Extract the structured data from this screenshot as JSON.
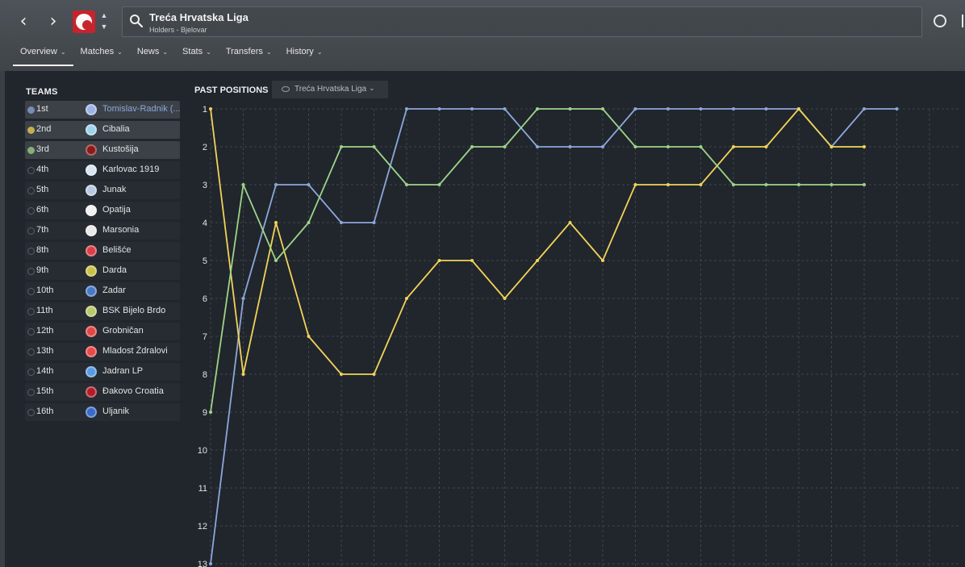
{
  "header": {
    "title": "Treća Hrvatska Liga",
    "subtitle": "Holders - Bjelovar",
    "back_glyph": "‹",
    "forward_glyph": "›",
    "tabs": [
      {
        "label": "Overview",
        "active": true
      },
      {
        "label": "Matches",
        "active": false
      },
      {
        "label": "News",
        "active": false
      },
      {
        "label": "Stats",
        "active": false
      },
      {
        "label": "Transfers",
        "active": false
      },
      {
        "label": "History",
        "active": false
      }
    ]
  },
  "teams": {
    "header": "TEAMS",
    "rows": [
      {
        "pos": "1st",
        "name": "Tomislav-Radnik (...",
        "crest": "#9db3e8",
        "marker": "#8ea6dc",
        "highlight": true,
        "link": true
      },
      {
        "pos": "2nd",
        "name": "Cibalia",
        "crest": "#9fd3ec",
        "marker": "#f2d35a",
        "highlight": true,
        "link": false
      },
      {
        "pos": "3rd",
        "name": "Kustošija",
        "crest": "#8b1a1a",
        "marker": "#9fd38a",
        "highlight": true,
        "link": false
      },
      {
        "pos": "4th",
        "name": "Karlovac 1919",
        "crest": "#d8e4f0",
        "highlight": false
      },
      {
        "pos": "5th",
        "name": "Junak",
        "crest": "#b8c8e0",
        "highlight": false
      },
      {
        "pos": "6th",
        "name": "Opatija",
        "crest": "#f2f2f2",
        "highlight": false
      },
      {
        "pos": "7th",
        "name": "Marsonia",
        "crest": "#e8e8e8",
        "highlight": false
      },
      {
        "pos": "8th",
        "name": "Belišće",
        "crest": "#d9404a",
        "highlight": false
      },
      {
        "pos": "9th",
        "name": "Darda",
        "crest": "#c9c24a",
        "highlight": false
      },
      {
        "pos": "10th",
        "name": "Zadar",
        "crest": "#4a78c8",
        "highlight": false
      },
      {
        "pos": "11th",
        "name": "BSK Bijelo Brdo",
        "crest": "#b8c86a",
        "highlight": false
      },
      {
        "pos": "12th",
        "name": "Grobničan",
        "crest": "#e04848",
        "highlight": false
      },
      {
        "pos": "13th",
        "name": "Mladost Ždralovi",
        "crest": "#e84a4a",
        "highlight": false
      },
      {
        "pos": "14th",
        "name": "Jadran LP",
        "crest": "#5a9ae0",
        "highlight": false
      },
      {
        "pos": "15th",
        "name": "Đakovo Croatia",
        "crest": "#b01c2a",
        "highlight": false
      },
      {
        "pos": "16th",
        "name": "Uljanik",
        "crest": "#3a6ac8",
        "highlight": false
      }
    ]
  },
  "past_positions": {
    "header": "PAST POSITIONS",
    "competition_select": "Treća Hrvatska Liga"
  },
  "chart_data": {
    "type": "line",
    "ylim": [
      1,
      13
    ],
    "y_ticks": [
      "1",
      "2",
      "3",
      "4",
      "5",
      "6",
      "7",
      "8",
      "9",
      "10",
      "11",
      "12",
      "13"
    ],
    "y_inverted": true,
    "grid": true,
    "x": [
      1,
      2,
      3,
      4,
      5,
      6,
      7,
      8,
      9,
      10,
      11,
      12,
      13,
      14,
      15,
      16,
      17,
      18,
      19,
      20,
      21,
      22
    ],
    "series": [
      {
        "name": "Tomislav-Radnik (...",
        "color": "#8ea6dc",
        "values": [
          13,
          6,
          3,
          3,
          4,
          4,
          1,
          1,
          1,
          1,
          2,
          2,
          2,
          1,
          1,
          1,
          1,
          1,
          1,
          2,
          1,
          1
        ]
      },
      {
        "name": "Cibalia",
        "color": "#f2d35a",
        "values": [
          1,
          8,
          4,
          7,
          8,
          8,
          6,
          5,
          5,
          6,
          5,
          4,
          5,
          3,
          3,
          3,
          2,
          2,
          1,
          2,
          2,
          null
        ]
      },
      {
        "name": "Kustošija",
        "color": "#9fd38a",
        "values": [
          9,
          3,
          5,
          4,
          2,
          2,
          3,
          3,
          2,
          2,
          1,
          1,
          1,
          2,
          2,
          2,
          3,
          3,
          3,
          3,
          3,
          null
        ]
      }
    ]
  }
}
